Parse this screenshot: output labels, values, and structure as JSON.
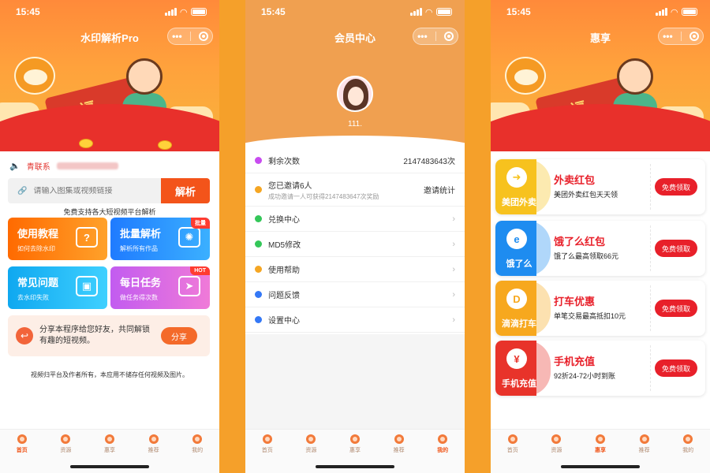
{
  "status_time": "15:45",
  "phone1": {
    "title": "水印解析Pro",
    "notice_label": "青联系",
    "notice_blurred": "QQ:1138006142",
    "search_placeholder": "请输入图集或视频链接",
    "parse_button": "解析",
    "support_text": "免费支持各大短视频平台解析",
    "tiles": [
      {
        "title": "使用教程",
        "sub": "如何去除水印",
        "tag": "",
        "icon": "help-icon",
        "color": "#ff8a1f"
      },
      {
        "title": "批量解析",
        "sub": "解析所有作品",
        "tag": "批量",
        "icon": "bulb-icon",
        "color": "#1f8bff"
      },
      {
        "title": "常见问题",
        "sub": "去水印失败",
        "tag": "",
        "icon": "tv-icon",
        "color": "#18b7f2"
      },
      {
        "title": "每日任务",
        "sub": "做任务得次数",
        "tag": "HOT",
        "icon": "send-icon",
        "color": "#d85ee8"
      }
    ],
    "share_text": "分享本程序给您好友，共同解锁有趣的短视频。",
    "share_button": "分享",
    "footer_text": "视频归平台及作者所有，本应用不储存任何视频及图片。",
    "active_tab": 0
  },
  "phone2": {
    "title": "会员中心",
    "username": "111.",
    "rows": [
      {
        "label": "剩余次数",
        "value": "2147483643次",
        "sub": "",
        "icon": "diamond-icon",
        "color": "#c84cf0"
      },
      {
        "label": "您已邀请6人",
        "value": "邀请统计",
        "sub": "成功邀请一人可获得2147483647次奖励",
        "icon": "invite-icon",
        "color": "#f5a623"
      },
      {
        "label": "兑换中心",
        "value": "",
        "sub": "",
        "icon": "shield-icon",
        "color": "#34c759"
      },
      {
        "label": "MD5修改",
        "value": "",
        "sub": "",
        "icon": "check-icon",
        "color": "#34c759"
      },
      {
        "label": "使用帮助",
        "value": "",
        "sub": "",
        "icon": "question-icon",
        "color": "#f5a623"
      },
      {
        "label": "问题反馈",
        "value": "",
        "sub": "",
        "icon": "chat-icon",
        "color": "#3478f6"
      },
      {
        "label": "设置中心",
        "value": "",
        "sub": "",
        "icon": "gear-icon",
        "color": "#3478f6"
      }
    ],
    "active_tab": 4
  },
  "phone3": {
    "title": "惠享",
    "coupons": [
      {
        "brand": "美团外卖",
        "title": "外卖红包",
        "desc": "美团外卖红包天天领",
        "button": "免费领取",
        "color": "#f7c21e",
        "title_color": "#e8202a",
        "icon": "meituan-icon",
        "glyph": "➜"
      },
      {
        "brand": "饿了么",
        "title": "饿了么红包",
        "desc": "饿了么最高领取66元",
        "button": "免费领取",
        "color": "#1e8cf0",
        "title_color": "#e8202a",
        "icon": "eleme-icon",
        "glyph": "e"
      },
      {
        "brand": "滴滴打车",
        "title": "打车优惠",
        "desc": "单笔交易最高抵扣10元",
        "button": "免费领取",
        "color": "#f7a81e",
        "title_color": "#e8202a",
        "icon": "didi-icon",
        "glyph": "D"
      },
      {
        "brand": "手机充值",
        "title": "手机充值",
        "desc": "92折24-72小时到账",
        "button": "免费领取",
        "color": "#e8332a",
        "title_color": "#e8202a",
        "icon": "recharge-icon",
        "glyph": "¥"
      }
    ],
    "active_tab": 2
  },
  "tabs": [
    "首页",
    "资源",
    "惠享",
    "推荐",
    "我的"
  ]
}
